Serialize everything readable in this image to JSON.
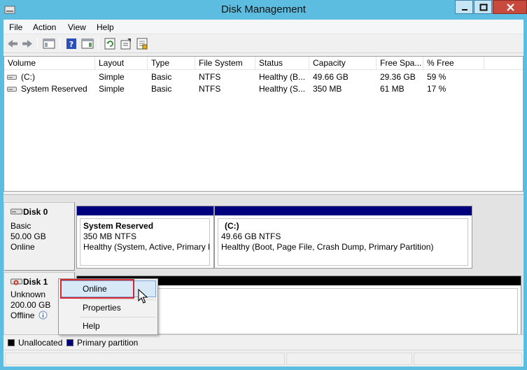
{
  "window": {
    "title": "Disk Management",
    "controls": {
      "minimize": "minimize",
      "maximize": "maximize",
      "close": "close"
    }
  },
  "menubar": {
    "items": [
      {
        "label": "File"
      },
      {
        "label": "Action"
      },
      {
        "label": "View"
      },
      {
        "label": "Help"
      }
    ]
  },
  "toolbar": {
    "icons": [
      "back-arrow-icon",
      "forward-arrow-icon",
      "console-tree-icon",
      "help-icon",
      "action-pane-icon",
      "refresh-icon",
      "properties-icon",
      "export-icon"
    ]
  },
  "volume_list": {
    "columns": [
      {
        "label": "Volume"
      },
      {
        "label": "Layout"
      },
      {
        "label": "Type"
      },
      {
        "label": "File System"
      },
      {
        "label": "Status"
      },
      {
        "label": "Capacity"
      },
      {
        "label": "Free Spa..."
      },
      {
        "label": "% Free"
      }
    ],
    "rows": [
      {
        "cells": [
          "(C:)",
          "Simple",
          "Basic",
          "NTFS",
          "Healthy (B...",
          "49.66 GB",
          "29.36 GB",
          "59 %"
        ]
      },
      {
        "cells": [
          "System Reserved",
          "Simple",
          "Basic",
          "NTFS",
          "Healthy (S...",
          "350 MB",
          "61 MB",
          "17 %"
        ]
      }
    ]
  },
  "disks": [
    {
      "name": "Disk 0",
      "type": "Basic",
      "size": "50.00 GB",
      "state": "Online",
      "partitions": [
        {
          "name": "System Reserved",
          "size": "350 MB NTFS",
          "status": "Healthy (System, Active, Primary P"
        },
        {
          "name": "(C:)",
          "size": "49.66 GB NTFS",
          "status": "Healthy (Boot, Page File, Crash Dump, Primary Partition)"
        }
      ]
    },
    {
      "name": "Disk 1",
      "type": "Unknown",
      "size": "200.00 GB",
      "state": "Offline"
    }
  ],
  "legend": {
    "items": [
      {
        "label": "Unallocated",
        "color": "#000000"
      },
      {
        "label": "Primary partition",
        "color": "#00007f"
      }
    ]
  },
  "context_menu": {
    "items": [
      {
        "label": "Online"
      },
      {
        "label": "Properties"
      },
      {
        "label": "Help"
      }
    ]
  },
  "colors": {
    "frame": "#5cbde0",
    "primary_partition": "#00007f",
    "unallocated": "#000000",
    "highlight": "#d8262f"
  }
}
